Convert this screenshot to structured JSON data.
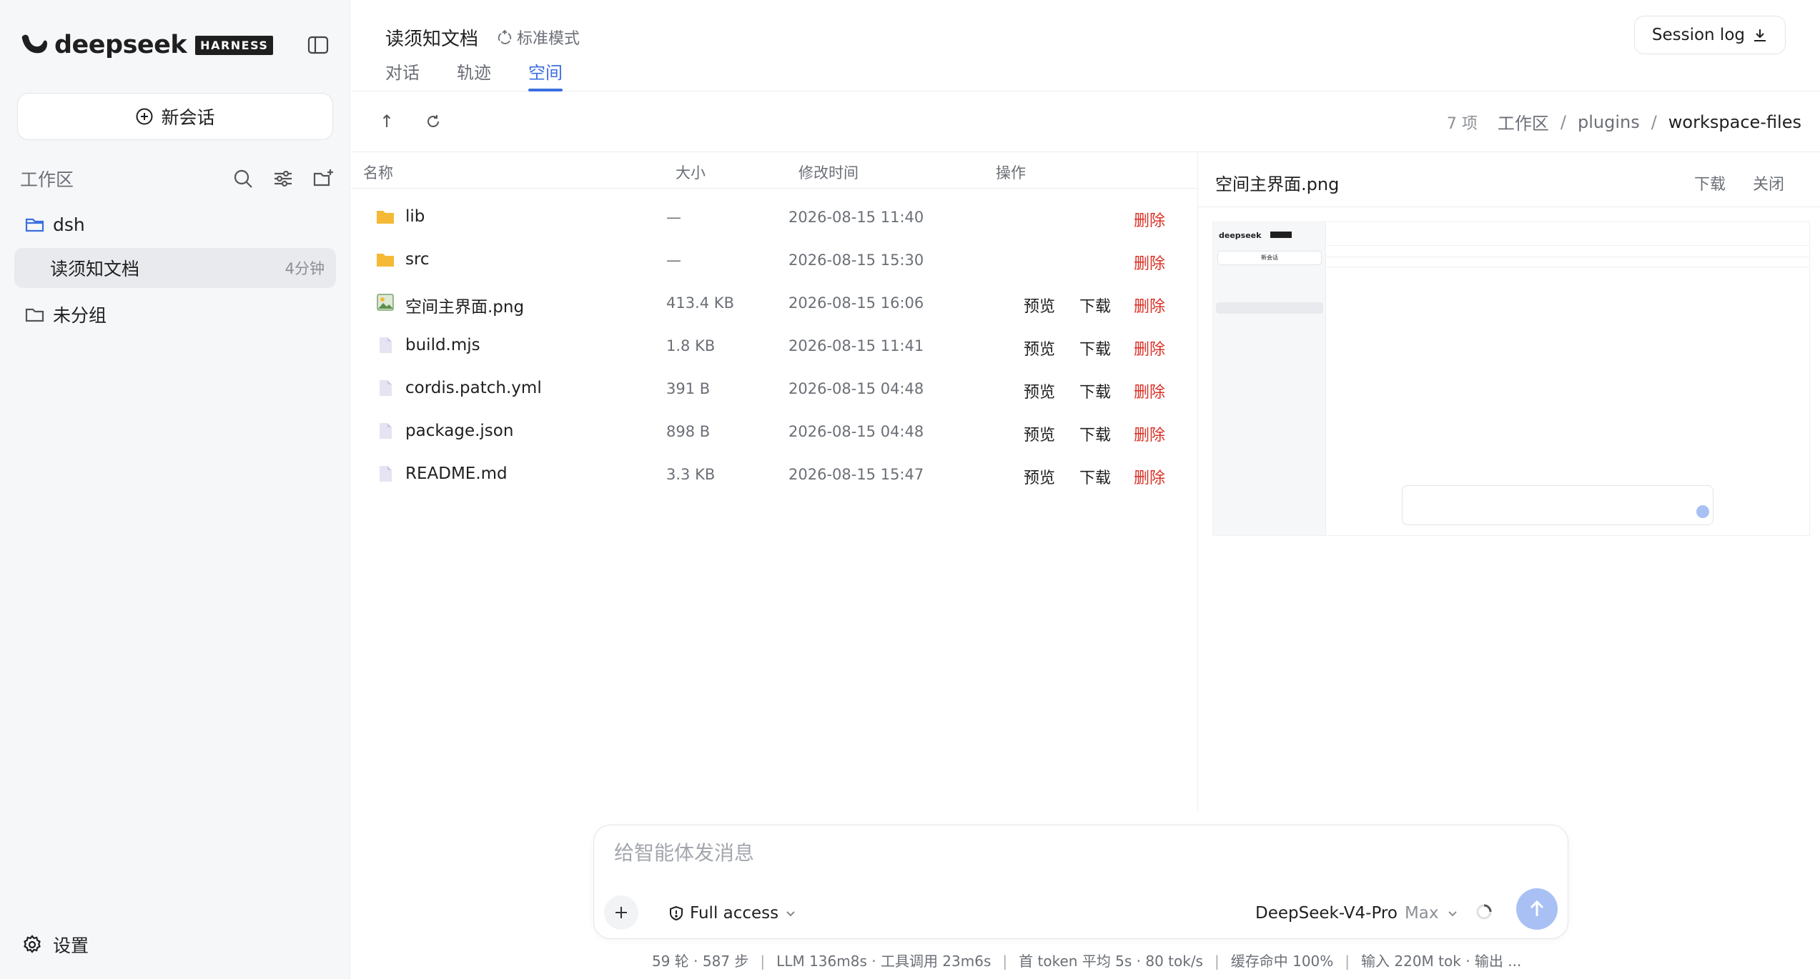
{
  "brand": {
    "name": "deepseek",
    "badge": "HARNESS"
  },
  "sidebar": {
    "new_chat": "新会话",
    "workspace_label": "工作区",
    "groups": [
      {
        "name": "dsh"
      },
      {
        "name": "读须知文档",
        "time": "4分钟"
      },
      {
        "name": "未分组"
      }
    ],
    "settings": "设置"
  },
  "header": {
    "doc_title": "读须知文档",
    "mode": "标准模式",
    "tabs": [
      "对话",
      "轨迹",
      "空间"
    ],
    "active_tab": "空间",
    "session_log": "Session log"
  },
  "toolbar": {
    "up": "↑",
    "count": "7 项",
    "breadcrumb": [
      "工作区",
      "plugins",
      "workspace-files"
    ]
  },
  "table": {
    "columns": [
      "名称",
      "大小",
      "修改时间",
      "操作"
    ],
    "actions": {
      "preview": "预览",
      "download": "下载",
      "delete": "删除"
    },
    "rows": [
      {
        "name": "lib",
        "size": "—",
        "modified": "2026-08-15 11:40",
        "type": "folder"
      },
      {
        "name": "src",
        "size": "—",
        "modified": "2026-08-15 15:30",
        "type": "folder"
      },
      {
        "name": "空间主界面.png",
        "size": "413.4 KB",
        "modified": "2026-08-15 16:06",
        "type": "image"
      },
      {
        "name": "build.mjs",
        "size": "1.8 KB",
        "modified": "2026-08-15 11:41",
        "type": "file"
      },
      {
        "name": "cordis.patch.yml",
        "size": "391 B",
        "modified": "2026-08-15 04:48",
        "type": "file"
      },
      {
        "name": "package.json",
        "size": "898 B",
        "modified": "2026-08-15 04:48",
        "type": "file"
      },
      {
        "name": "README.md",
        "size": "3.3 KB",
        "modified": "2026-08-15 15:47",
        "type": "file"
      }
    ]
  },
  "preview": {
    "title": "空间主界面.png",
    "download": "下载",
    "close": "关闭"
  },
  "composer": {
    "placeholder": "给智能体发消息",
    "access": "Full access",
    "model": "DeepSeek-V4-Pro",
    "tier": "Max"
  },
  "status": {
    "items": [
      "59 轮 · 587 步",
      "LLM 136m8s · 工具调用 23m6s",
      "首 token 平均 5s · 80 tok/s",
      "缓存命中 100%",
      "输入 220M tok · 输出 ..."
    ]
  },
  "colors": {
    "accent": "#3b6fe0",
    "danger": "#d93025",
    "folder": "#f5b935"
  }
}
